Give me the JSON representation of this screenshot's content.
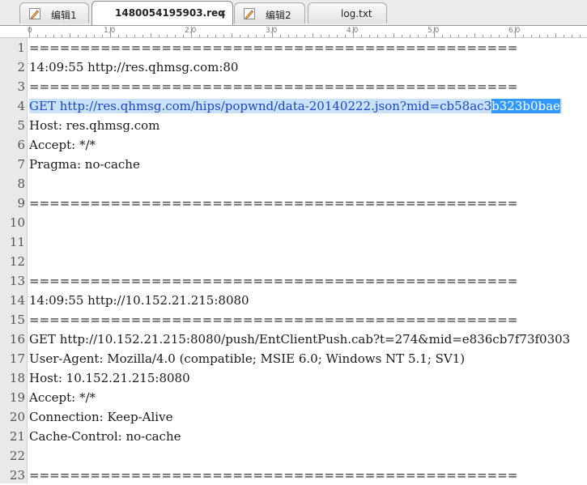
{
  "tabs": [
    {
      "label": "编辑1",
      "active": false,
      "icon": "edit-doc-icon"
    },
    {
      "label": "1480054195903.req",
      "active": true,
      "close": "×"
    },
    {
      "label": "编辑2",
      "active": false,
      "icon": "edit-doc-icon"
    },
    {
      "label": "log.txt",
      "active": false
    }
  ],
  "ruler": {
    "marks": [
      "0",
      "1,0",
      "2,0",
      "3,0",
      "4,0",
      "5,0",
      "6,0"
    ]
  },
  "editor": {
    "lines": [
      {
        "num": "1",
        "text": "================================================"
      },
      {
        "num": "2",
        "text": "14:09:55  http://res.qhmsg.com:80"
      },
      {
        "num": "3",
        "text": "================================================"
      },
      {
        "num": "4",
        "text": "GET http://res.qhmsg.com/hips/popwnd/data-20140222.json?mid=cb58ac3",
        "sel_text": "b323b0bae",
        "selected": true
      },
      {
        "num": "5",
        "text": "Host: res.qhmsg.com"
      },
      {
        "num": "6",
        "text": "Accept: */*"
      },
      {
        "num": "7",
        "text": "Pragma: no-cache"
      },
      {
        "num": "8",
        "text": ""
      },
      {
        "num": "9",
        "text": "================================================"
      },
      {
        "num": "10",
        "text": ""
      },
      {
        "num": "11",
        "text": ""
      },
      {
        "num": "12",
        "text": ""
      },
      {
        "num": "13",
        "text": "================================================"
      },
      {
        "num": "14",
        "text": "14:09:55  http://10.152.21.215:8080"
      },
      {
        "num": "15",
        "text": "================================================"
      },
      {
        "num": "16",
        "text": "GET http://10.152.21.215:8080/push/EntClientPush.cab?t=274&mid=e836cb7f73f0303"
      },
      {
        "num": "17",
        "text": "User-Agent: Mozilla/4.0 (compatible; MSIE 6.0; Windows NT 5.1; SV1)"
      },
      {
        "num": "18",
        "text": "Host: 10.152.21.215:8080"
      },
      {
        "num": "19",
        "text": "Accept: */*"
      },
      {
        "num": "20",
        "text": "Connection: Keep-Alive"
      },
      {
        "num": "21",
        "text": "Cache-Control: no-cache"
      },
      {
        "num": "22",
        "text": ""
      },
      {
        "num": "23",
        "text": "================================================"
      }
    ]
  },
  "colors": {
    "selection_line": "#c9e2f7",
    "selection_strong": "#3399ff",
    "link_text": "#1e46c8"
  }
}
